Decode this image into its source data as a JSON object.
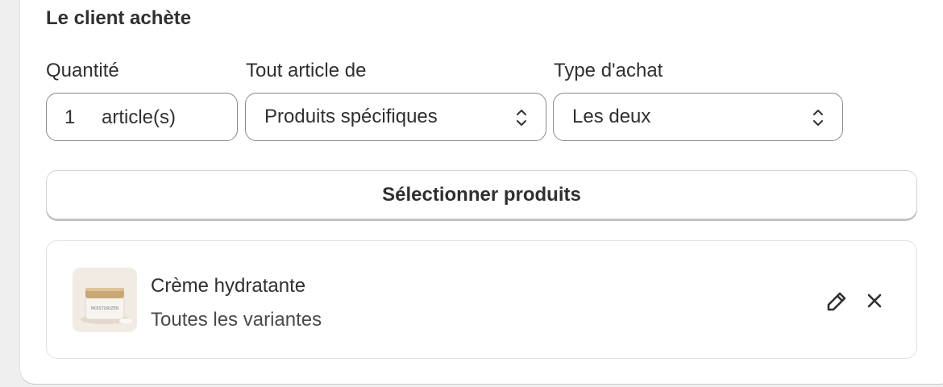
{
  "section": {
    "title": "Le client achète"
  },
  "fields": {
    "quantity": {
      "label": "Quantité",
      "value": "1",
      "suffix": "article(s)"
    },
    "items_from": {
      "label": "Tout article de",
      "selected": "Produits spécifiques"
    },
    "purchase_type": {
      "label": "Type d'achat",
      "selected": "Les deux"
    }
  },
  "select_products_button": {
    "label": "Sélectionner produits"
  },
  "product": {
    "name": "Crème hydratante",
    "variants": "Toutes les variantes",
    "thumbnail_label": "MOISTURIZER"
  },
  "icons": {
    "select_chevron": "chevron-up-down-icon",
    "edit": "pencil-icon",
    "remove": "close-icon"
  },
  "colors": {
    "text": "#303030",
    "border": "#8a8a8a",
    "background": "#efefef",
    "card": "#ffffff"
  }
}
